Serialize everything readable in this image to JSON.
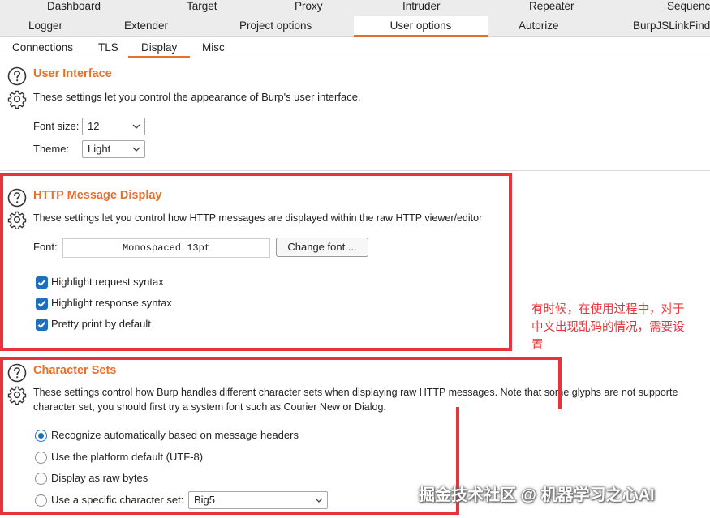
{
  "tabs": {
    "row1": [
      "Dashboard",
      "Target",
      "Proxy",
      "Intruder",
      "Repeater",
      "Sequence"
    ],
    "row2": [
      "Logger",
      "Extender",
      "Project options",
      "User options",
      "Autorize",
      "BurpJSLinkFinde"
    ]
  },
  "subtabs": [
    "Connections",
    "TLS",
    "Display",
    "Misc"
  ],
  "user_interface": {
    "title": "User Interface",
    "description": "These settings let you control the appearance of Burp's user interface.",
    "font_size_label": "Font size:",
    "font_size_value": "12",
    "theme_label": "Theme:",
    "theme_value": "Light"
  },
  "http_message_display": {
    "title": "HTTP Message Display",
    "description": "These settings let you control how HTTP messages are displayed within the raw HTTP viewer/editor",
    "font_label": "Font:",
    "font_value": "Monospaced 13pt",
    "change_font_label": "Change font ...",
    "checkboxes": [
      {
        "label": "Highlight request syntax",
        "checked": true
      },
      {
        "label": "Highlight response syntax",
        "checked": true
      },
      {
        "label": "Pretty print by default",
        "checked": true
      }
    ]
  },
  "character_sets": {
    "title": "Character Sets",
    "description_line1": "These settings control how Burp handles different character sets when displaying raw HTTP messages. Note that some glyphs are not supporte",
    "description_line2": "character set, you should first try a system font such as Courier New or Dialog.",
    "options": [
      {
        "label": "Recognize automatically based on message headers",
        "selected": true
      },
      {
        "label": "Use the platform default (UTF-8)",
        "selected": false
      },
      {
        "label": "Display as raw bytes",
        "selected": false
      },
      {
        "label": "Use a specific character set:",
        "selected": false
      }
    ],
    "charset_value": "Big5"
  },
  "annotation": {
    "line1": "有时候，在使用过程中，对于",
    "line2": "中文出现乱码的情况，需要设",
    "line3": "置"
  },
  "watermark": "掘金技术社区 @ 机器学习之心AI",
  "colors": {
    "accent": "#e8702a",
    "annotation_red": "#e8333a",
    "control_blue": "#1e6fbf"
  }
}
